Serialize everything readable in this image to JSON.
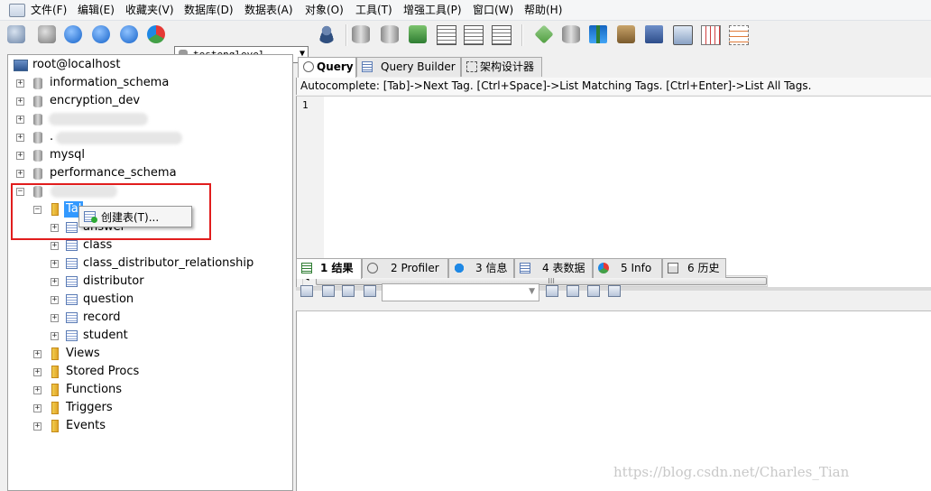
{
  "menu": [
    "文件(F)",
    "编辑(E)",
    "收藏夹(V)",
    "数据库(D)",
    "数据表(A)",
    "对象(O)",
    "工具(T)",
    "增强工具(P)",
    "窗口(W)",
    "帮助(H)"
  ],
  "toolbar": {
    "database_select": "testenglevel",
    "icons": [
      "connect-icon",
      "new-connection-icon",
      "back-icon",
      "forward-icon",
      "refresh-icon",
      "query-icon",
      "user-manager-icon",
      "backup-icon",
      "restore-icon",
      "import-icon",
      "export-icon",
      "schema-icon",
      "sync-icon",
      "table-icon",
      "wizard-icon",
      "data-sync-icon",
      "copy-icon",
      "settings-icon",
      "report-icon",
      "layout-icon"
    ]
  },
  "tree": {
    "root": "root@localhost",
    "databases": [
      {
        "name": "information_schema"
      },
      {
        "name": "encryption_dev"
      },
      {
        "name": ""
      },
      {
        "name": "."
      },
      {
        "name": "mysql"
      },
      {
        "name": "performance_schema"
      },
      {
        "name": ""
      }
    ],
    "tables_folder": "Tal",
    "tables": [
      "answer",
      "class",
      "class_distributor_relationship",
      "distributor",
      "question",
      "record",
      "student"
    ],
    "folders": [
      "Views",
      "Stored Procs",
      "Functions",
      "Triggers",
      "Events"
    ]
  },
  "context_menu": {
    "create_table": "创建表(T)..."
  },
  "query_tabs": [
    "Query",
    "Query Builder",
    "架构设计器"
  ],
  "autocomplete_hint": "Autocomplete: [Tab]->Next Tag. [Ctrl+Space]->List Matching Tags. [Ctrl+Enter]->List All Tags.",
  "editor": {
    "line_number": "1"
  },
  "result_tabs": [
    "1 结果",
    "2 Profiler",
    "3 信息",
    "4 表数据",
    "5 Info",
    "6 历史"
  ],
  "watermark": "https://blog.csdn.net/Charles_Tian"
}
